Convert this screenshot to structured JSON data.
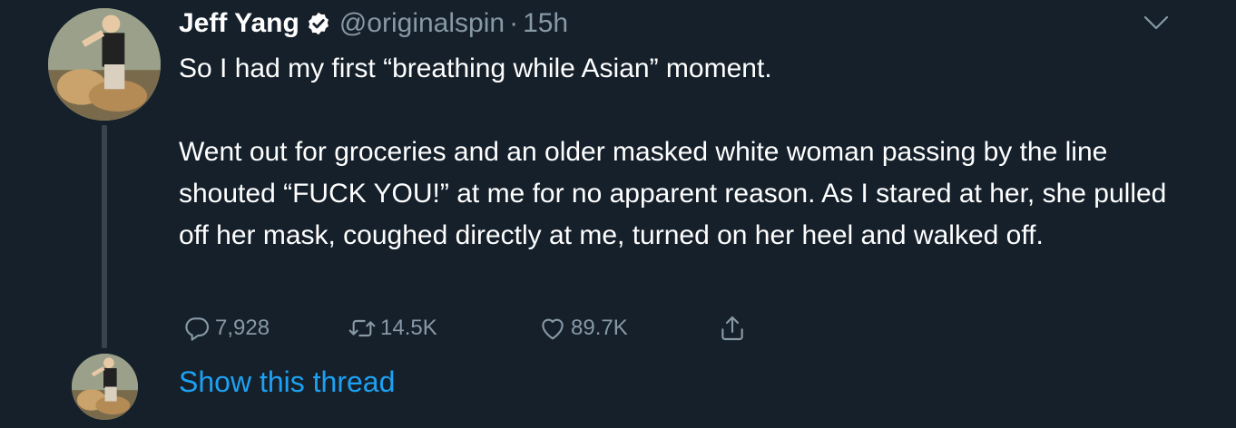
{
  "tweet": {
    "author_name": "Jeff Yang",
    "handle": "@originalspin",
    "separator": "·",
    "time": "15h",
    "verified": true,
    "text_paragraphs": [
      "So I had my first “breathing while Asian” moment.",
      "Went out for groceries and an older masked white woman passing by the line shouted “FUCK YOU!” at me for no apparent reason. As I stared at her, she pulled off her mask, coughed directly at me, turned on her heel and walked off."
    ],
    "actions": {
      "reply_count": "7,928",
      "retweet_count": "14.5K",
      "like_count": "89.7K"
    }
  },
  "thread": {
    "show_label": "Show this thread"
  },
  "icons": {
    "verified": "verified-badge-icon",
    "menu": "chevron-down-icon",
    "reply": "reply-icon",
    "retweet": "retweet-icon",
    "like": "heart-icon",
    "share": "share-icon"
  },
  "colors": {
    "background": "#15202b",
    "text": "#ffffff",
    "secondary": "#8899a6",
    "link": "#1da1f2",
    "thread_line": "#38444d"
  }
}
